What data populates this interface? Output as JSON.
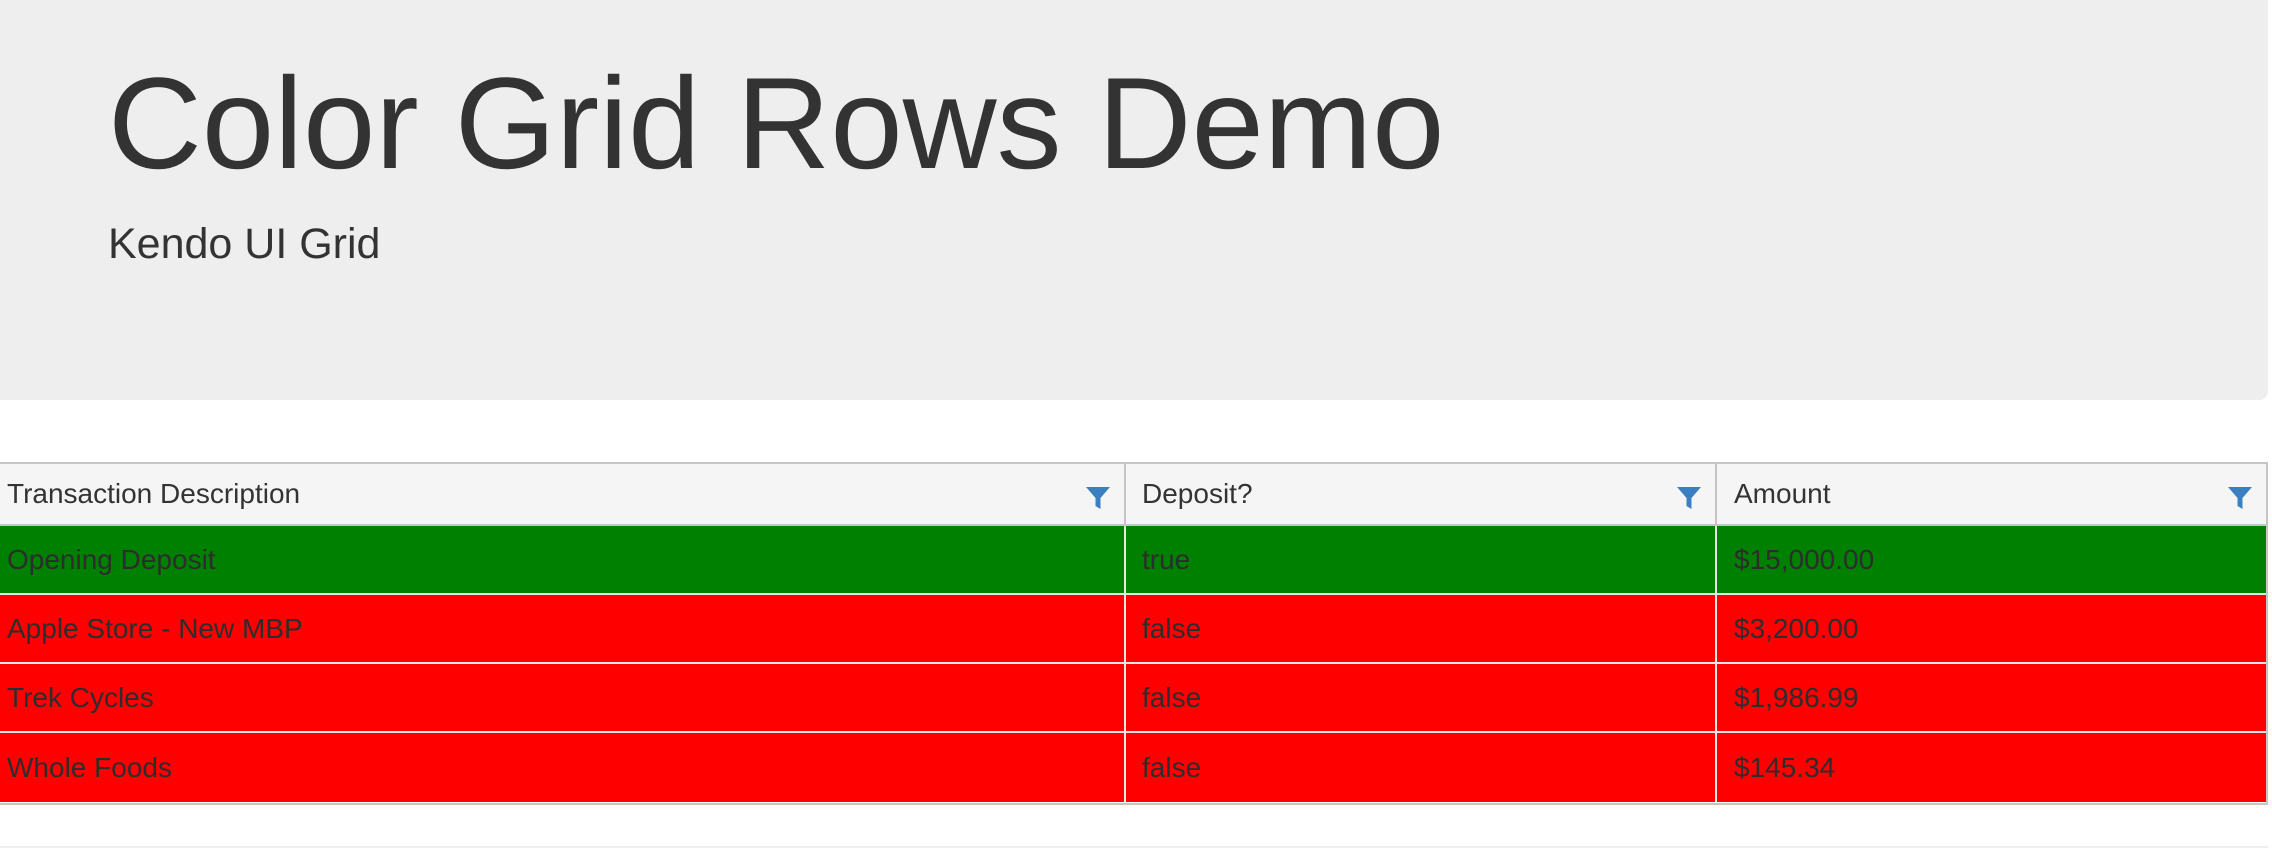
{
  "header": {
    "title": "Color Grid Rows Demo",
    "subtitle": "Kendo UI Grid"
  },
  "grid": {
    "columns": [
      {
        "label": "Transaction Description",
        "filter_icon": "filter-icon"
      },
      {
        "label": "Deposit?",
        "filter_icon": "filter-icon"
      },
      {
        "label": "Amount",
        "filter_icon": "filter-icon"
      }
    ],
    "rows": [
      {
        "description": "Opening Deposit",
        "deposit": "true",
        "amount": "$15,000.00",
        "row_color": "#008000"
      },
      {
        "description": "Apple Store - New MBP",
        "deposit": "false",
        "amount": "$3,200.00",
        "row_color": "#ff0000"
      },
      {
        "description": "Trek Cycles",
        "deposit": "false",
        "amount": "$1,986.99",
        "row_color": "#ff0000"
      },
      {
        "description": "Whole Foods",
        "deposit": "false",
        "amount": "$145.34",
        "row_color": "#ff0000"
      }
    ]
  },
  "colors": {
    "deposit_row": "#008000",
    "withdrawal_row": "#ff0000",
    "filter_icon": "#3a7fc1",
    "jumbotron_bg": "#eeeeee"
  }
}
